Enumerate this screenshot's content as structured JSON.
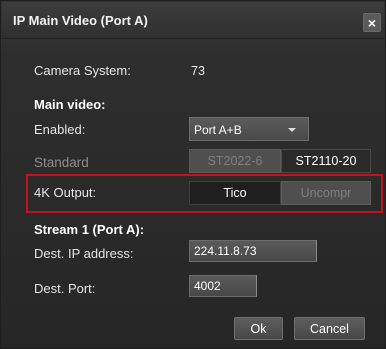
{
  "window": {
    "title": "IP Main Video (Port A)",
    "close_glyph": "×",
    "close_icon": "close-icon"
  },
  "camera": {
    "label": "Camera System:",
    "value": "73"
  },
  "main_video": {
    "heading": "Main video:",
    "enabled_label": "Enabled:",
    "enabled_value": "Port A+B",
    "enabled_icon": "chevron-down-icon"
  },
  "standard": {
    "label": "Standard",
    "options": [
      "ST2022-6",
      "ST2110-20"
    ],
    "selected": "ST2110-20"
  },
  "output_4k": {
    "label": "4K Output:",
    "options": [
      "Tico",
      "Uncompr"
    ],
    "selected": "Tico",
    "highlight_color": "#c8101e"
  },
  "stream1": {
    "heading": "Stream 1 (Port A):",
    "ip_label": "Dest. IP address:",
    "ip_value": "224.11.8.73",
    "port_label": "Dest. Port:",
    "port_value": "4002"
  },
  "buttons": {
    "ok": "Ok",
    "cancel": "Cancel"
  }
}
